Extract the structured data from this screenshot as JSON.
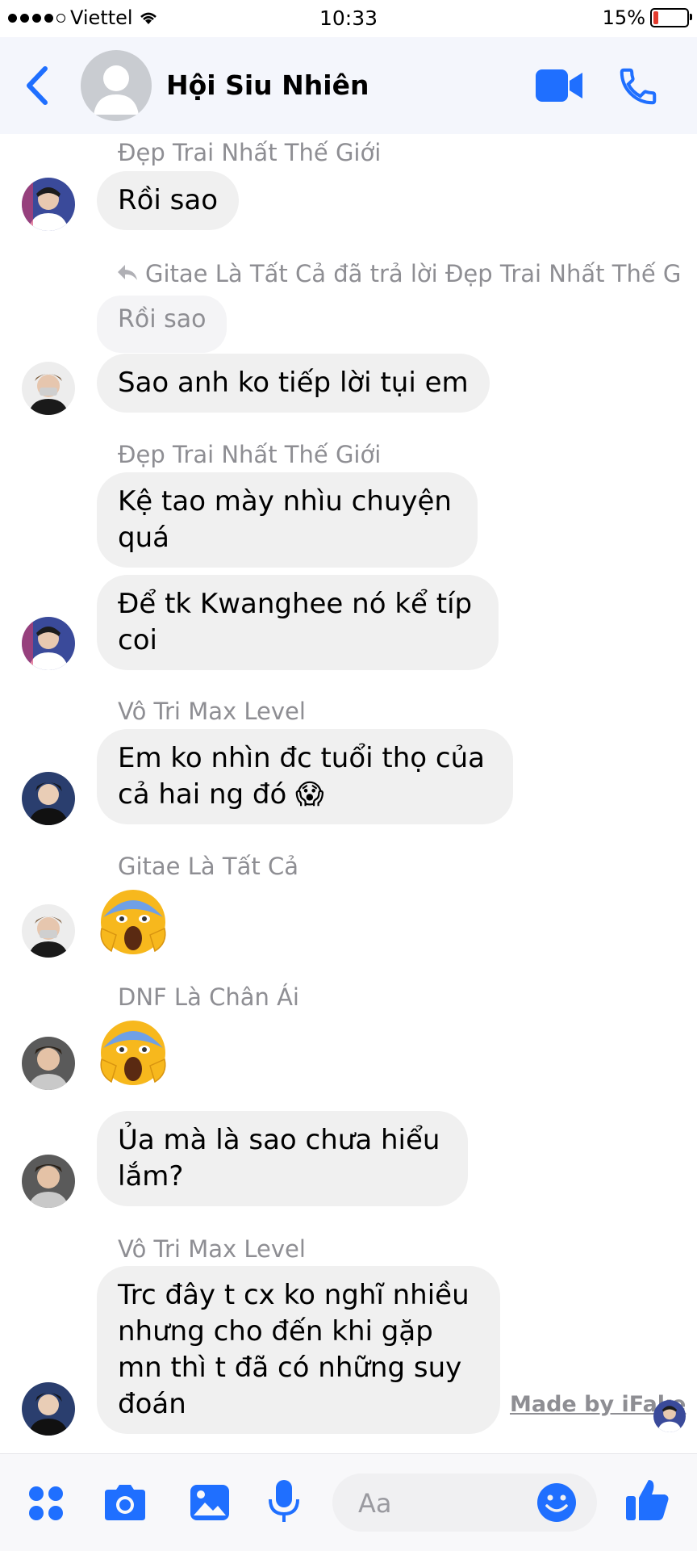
{
  "status_bar": {
    "carrier": "Viettel",
    "time": "10:33",
    "battery_percent": "15%",
    "battery_level": 0.15,
    "signal_bars_filled": 4,
    "signal_bars_total": 5
  },
  "header": {
    "title": "Hội Siu Nhiên",
    "icons": [
      "back-chevron-icon",
      "video-call-icon",
      "phone-icon"
    ]
  },
  "messages": [
    {
      "sender": "Đẹp Trai Nhất Thế Giới",
      "bubbles": [
        "Rồi sao"
      ]
    },
    {
      "reply_note": "Gitae Là Tất Cả đã trả lời Đẹp Trai Nhất Thế G",
      "quoted": "Rồi sao",
      "bubbles": [
        "Sao anh ko tiếp lời tụi em"
      ]
    },
    {
      "sender": "Đẹp Trai Nhất Thế Giới",
      "bubbles": [
        "Kệ tao mày nhìu chuyện quá",
        "Để tk Kwanghee nó kể típ coi"
      ]
    },
    {
      "sender": "Vô Tri Max Level",
      "bubbles": [
        "Em ko nhìn đc tuổi thọ của cả hai ng đó 😱"
      ]
    },
    {
      "sender": "Gitae Là Tất Cả",
      "emoji": "😱"
    },
    {
      "sender": "DNF Là Chân Ái",
      "emoji": "😱",
      "bubbles": [
        "Ủa mà là sao chưa hiểu lắm?"
      ]
    },
    {
      "sender": "Vô Tri Max Level",
      "bubbles": [
        "Trc đây t cx ko nghĩ nhiều nhưng cho đến khi gặp mn thì t đã có những suy đoán"
      ]
    }
  ],
  "watermark": "Made by iFake",
  "composer": {
    "placeholder": "Aa",
    "icons": [
      "apps-grid-icon",
      "camera-icon",
      "image-icon",
      "microphone-icon",
      "emoji-icon",
      "thumbs-up-icon"
    ]
  },
  "colors": {
    "accent": "#1f6fff",
    "bubble": "#f0f0f0",
    "sender_gray": "#8e8e93",
    "header_bg": "#f4f6fc"
  }
}
